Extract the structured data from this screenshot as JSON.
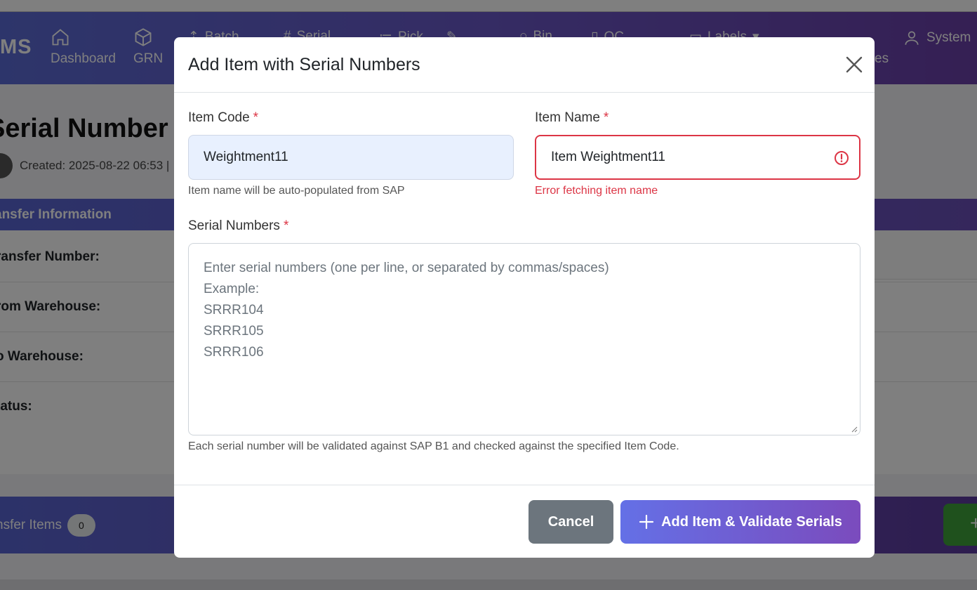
{
  "app": {
    "brand": "MS",
    "nav": {
      "dashboard": "Dashboard",
      "grn": "GRN",
      "batch": "Batch",
      "serial": "Serial",
      "pick": "Pick",
      "bin": "Bin",
      "qc": "QC",
      "labels": "Labels",
      "es": "es",
      "system": "System"
    }
  },
  "page": {
    "title": "Serial Number Tr",
    "created": "Created: 2025-08-22 06:53 |",
    "info_header": "ansfer Information",
    "rows": [
      "ransfer Number:",
      "rom Warehouse:",
      "o Warehouse:",
      "tatus:"
    ],
    "items_label": "nsfer Items",
    "items_count": "0",
    "add_button_glyph": "+"
  },
  "modal": {
    "title": "Add Item with Serial Numbers",
    "item_code": {
      "label": "Item Code",
      "required_mark": "*",
      "value": "Weightment11",
      "help": "Item name will be auto-populated from SAP"
    },
    "item_name": {
      "label": "Item Name",
      "required_mark": "*",
      "value": "Item Weightment11",
      "error": "Error fetching item name"
    },
    "serials": {
      "label": "Serial Numbers",
      "required_mark": "*",
      "placeholder_lines": [
        "Enter serial numbers (one per line, or separated by commas/spaces)",
        "Example:",
        "SRRR104",
        "SRRR105",
        "SRRR106"
      ],
      "help": "Each serial number will be validated against SAP B1 and checked against the specified Item Code."
    },
    "buttons": {
      "cancel": "Cancel",
      "add": "Add Item & Validate Serials"
    }
  },
  "colors": {
    "accent": "#6470e6",
    "error": "#dc3545",
    "secondary": "#6c757d"
  }
}
